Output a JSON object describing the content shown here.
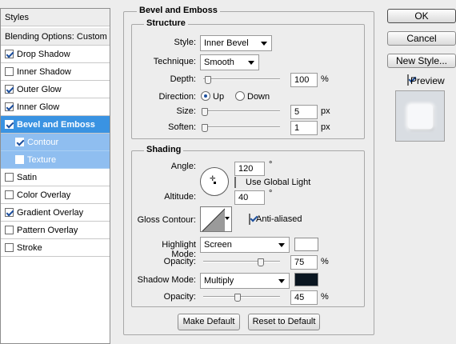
{
  "left_panel": {
    "styles_header": "Styles",
    "blending_options": "Blending Options: Custom",
    "items": [
      {
        "label": "Drop Shadow",
        "checked": true
      },
      {
        "label": "Inner Shadow",
        "checked": false
      },
      {
        "label": "Outer Glow",
        "checked": true
      },
      {
        "label": "Inner Glow",
        "checked": true
      },
      {
        "label": "Bevel and Emboss",
        "checked": true
      },
      {
        "label": "Contour",
        "checked": true
      },
      {
        "label": "Texture",
        "checked": false
      },
      {
        "label": "Satin",
        "checked": false
      },
      {
        "label": "Color Overlay",
        "checked": false
      },
      {
        "label": "Gradient Overlay",
        "checked": true
      },
      {
        "label": "Pattern Overlay",
        "checked": false
      },
      {
        "label": "Stroke",
        "checked": false
      }
    ]
  },
  "bevel": {
    "title": "Bevel and Emboss",
    "structure_title": "Structure",
    "style_label": "Style:",
    "style_value": "Inner Bevel",
    "technique_label": "Technique:",
    "technique_value": "Smooth",
    "depth_label": "Depth:",
    "depth_value": "100",
    "depth_unit": "%",
    "depth_level": 0.06,
    "direction_label": "Direction:",
    "direction_up": "Up",
    "direction_down": "Down",
    "size_label": "Size:",
    "size_value": "5",
    "size_unit": "px",
    "size_level": 0.02,
    "soften_label": "Soften:",
    "soften_value": "1",
    "soften_unit": "px",
    "soften_level": 0.02
  },
  "shading": {
    "title": "Shading",
    "angle_label": "Angle:",
    "angle_value": "120",
    "degree": "°",
    "use_global_light": "Use Global Light",
    "altitude_label": "Altitude:",
    "altitude_value": "40",
    "gloss_contour_label": "Gloss Contour:",
    "anti_aliased": "Anti-aliased",
    "highlight_mode_label": "Highlight Mode:",
    "highlight_mode_value": "Screen",
    "highlight_color": "#ffffff",
    "opacity_label": "Opacity:",
    "highlight_opacity_value": "75",
    "highlight_opacity_level": 0.75,
    "shadow_mode_label": "Shadow Mode:",
    "shadow_mode_value": "Multiply",
    "shadow_color": "#0a1621",
    "shadow_opacity_value": "45",
    "shadow_opacity_level": 0.45,
    "percent": "%"
  },
  "buttons": {
    "make_default": "Make Default",
    "reset_default": "Reset to Default",
    "ok": "OK",
    "cancel": "Cancel",
    "new_style": "New Style...",
    "preview": "Preview"
  },
  "colors": {
    "selected_row": "#3a93e2",
    "sub_row": "#8fbef0"
  }
}
